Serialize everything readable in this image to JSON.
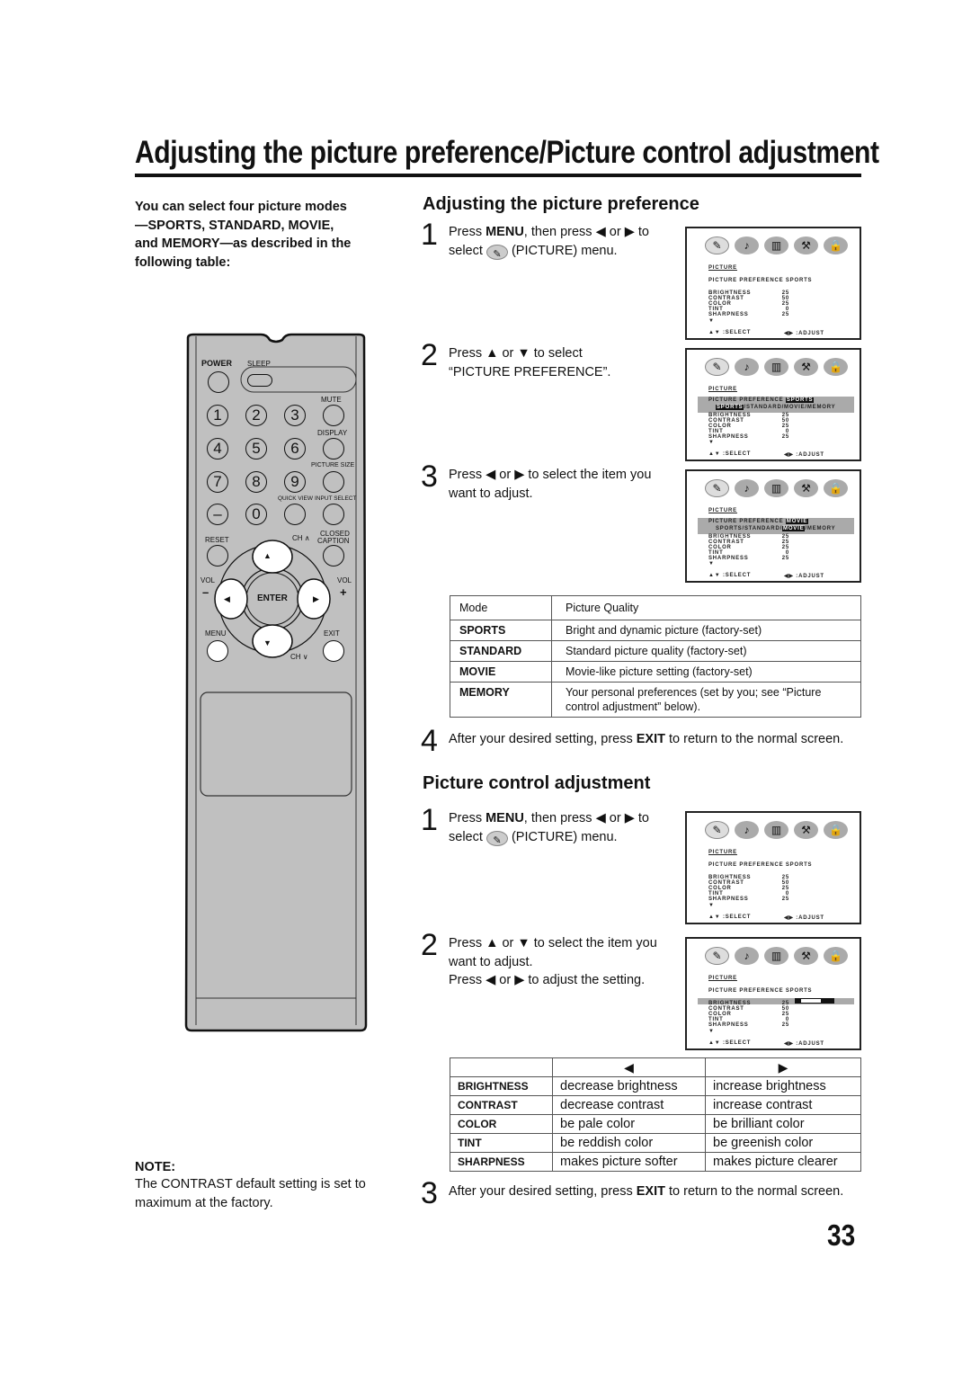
{
  "page": {
    "title": "Adjusting the picture preference/Picture control adjustment",
    "page_number": "33"
  },
  "intro": "You can select four picture modes—SPORTS, STANDARD, MOVIE, and MEMORY—as described in the following table:",
  "note": {
    "title": "NOTE:",
    "text": "The CONTRAST default setting is set to maximum at the factory."
  },
  "section1": {
    "heading": "Adjusting the picture preference",
    "steps": [
      {
        "num": "1",
        "pre": "Press ",
        "bold": "MENU",
        "post": ", then press ◀ or ▶ to select",
        "post2": "(PICTURE) menu."
      },
      {
        "num": "2",
        "text": "Press ▲ or ▼ to select “PICTURE PREFERENCE”."
      },
      {
        "num": "3",
        "text": "Press ◀ or ▶ to select the item you want to adjust."
      },
      {
        "num": "4",
        "pre": "After your desired setting, press ",
        "bold": "EXIT",
        "post": " to return to the normal screen."
      }
    ],
    "table": {
      "headers": [
        "Mode",
        "Picture Quality"
      ],
      "rows": [
        {
          "mode": "SPORTS",
          "desc": "Bright and dynamic picture (factory-set)"
        },
        {
          "mode": "STANDARD",
          "desc": "Standard picture quality (factory-set)"
        },
        {
          "mode": "MOVIE",
          "desc": "Movie-like picture setting (factory-set)"
        },
        {
          "mode": "MEMORY",
          "desc": "Your personal preferences (set by you; see “Picture control adjustment” below)."
        }
      ]
    }
  },
  "section2": {
    "heading": "Picture control adjustment",
    "steps": [
      {
        "num": "1",
        "pre": "Press ",
        "bold": "MENU",
        "post": ", then press ◀ or ▶ to select",
        "post2": "(PICTURE) menu."
      },
      {
        "num": "2",
        "text": "Press ▲ or ▼ to select the item you want to adjust.",
        "text2": "Press ◀ or ▶ to adjust the setting."
      },
      {
        "num": "3",
        "pre": "After your desired setting, press ",
        "bold": "EXIT",
        "post": " to return to the normal screen."
      }
    ],
    "table": {
      "headers": [
        "",
        "◀",
        "▶"
      ],
      "rows": [
        {
          "item": "BRIGHTNESS",
          "left": "decrease brightness",
          "right": "increase brightness"
        },
        {
          "item": "CONTRAST",
          "left": "decrease contrast",
          "right": "increase contrast"
        },
        {
          "item": "COLOR",
          "left": "be pale color",
          "right": "be brilliant color"
        },
        {
          "item": "TINT",
          "left": "be reddish color",
          "right": "be greenish color"
        },
        {
          "item": "SHARPNESS",
          "left": "makes picture softer",
          "right": "makes picture clearer"
        }
      ]
    }
  },
  "osd": {
    "icons": [
      "picture-icon",
      "audio-icon",
      "setup-icon",
      "tools-icon",
      "lock-icon"
    ],
    "icon_glyphs": [
      "✎",
      "♪",
      "▥",
      "⚒",
      "🔒"
    ],
    "menu_label": "PICTURE",
    "pref_label": "PICTURE PREFERENCE",
    "pref_sports": "SPORTS",
    "pref_movie": "MOVIE",
    "options_line": [
      "SPORTS",
      "/STANDARD/",
      "MOVIE",
      "/MEMORY"
    ],
    "items": [
      "BRIGHTNESS",
      "CONTRAST",
      "COLOR",
      "TINT",
      "SHARPNESS"
    ],
    "values_sports": [
      "25",
      "50",
      "25",
      "0",
      "25"
    ],
    "values_movie": [
      "25",
      "25",
      "25",
      "0",
      "25"
    ],
    "select_hint": "▲▼ :SELECT",
    "adjust_hint": "◀▶ :ADJUST",
    "more": "▼",
    "brightness_level": 0.5
  },
  "remote": {
    "power": "POWER",
    "sleep": "SLEEP",
    "mute": "MUTE",
    "display": "DISPLAY",
    "picture_size": "PICTURE SIZE",
    "quick_view": "QUICK VIEW",
    "input_select": "INPUT SELECT",
    "reset": "RESET",
    "ch_up": "CH ∧",
    "ch_down": "CH ∨",
    "closed_caption_1": "CLOSED",
    "closed_caption_2": "CAPTION",
    "vol": "VOL",
    "vol_minus": "–",
    "vol_plus": "+",
    "enter": "ENTER",
    "menu": "MENU",
    "exit": "EXIT",
    "digits": [
      "1",
      "2",
      "3",
      "4",
      "5",
      "6",
      "7",
      "8",
      "9",
      "–",
      "0"
    ],
    "arrows": {
      "up": "▲",
      "down": "▼",
      "left": "◀",
      "right": "▶"
    }
  }
}
